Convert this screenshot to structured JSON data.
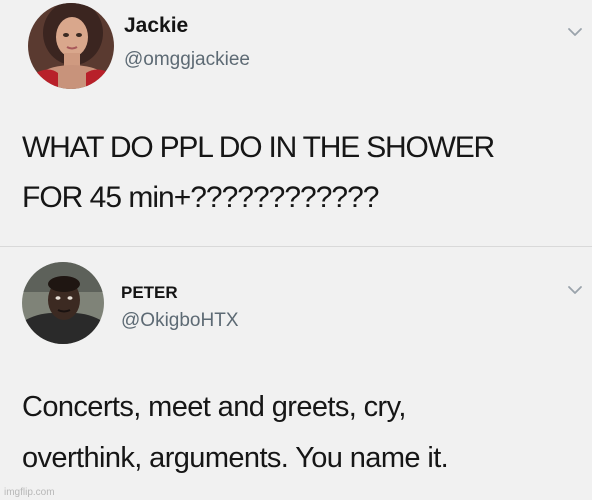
{
  "tweets": [
    {
      "name": "Jackie",
      "handle": "@omggjackiee",
      "text_lines": [
        "WHAT DO PPL DO IN THE SHOWER",
        "FOR 45 min+????????????"
      ]
    },
    {
      "name": "PETER",
      "handle": "@OkigboHTX",
      "text_lines": [
        "Concerts, meet and greets, cry,",
        "overthink, arguments. You name it."
      ]
    }
  ],
  "watermark": "imgflip.com",
  "icons": {
    "menu": "chevron-down-icon",
    "avatar": "profile-photo"
  },
  "colors": {
    "background": "#f1f1f1",
    "text": "#151515",
    "handle": "#5d6a74",
    "chevron": "#9aa3ab"
  }
}
